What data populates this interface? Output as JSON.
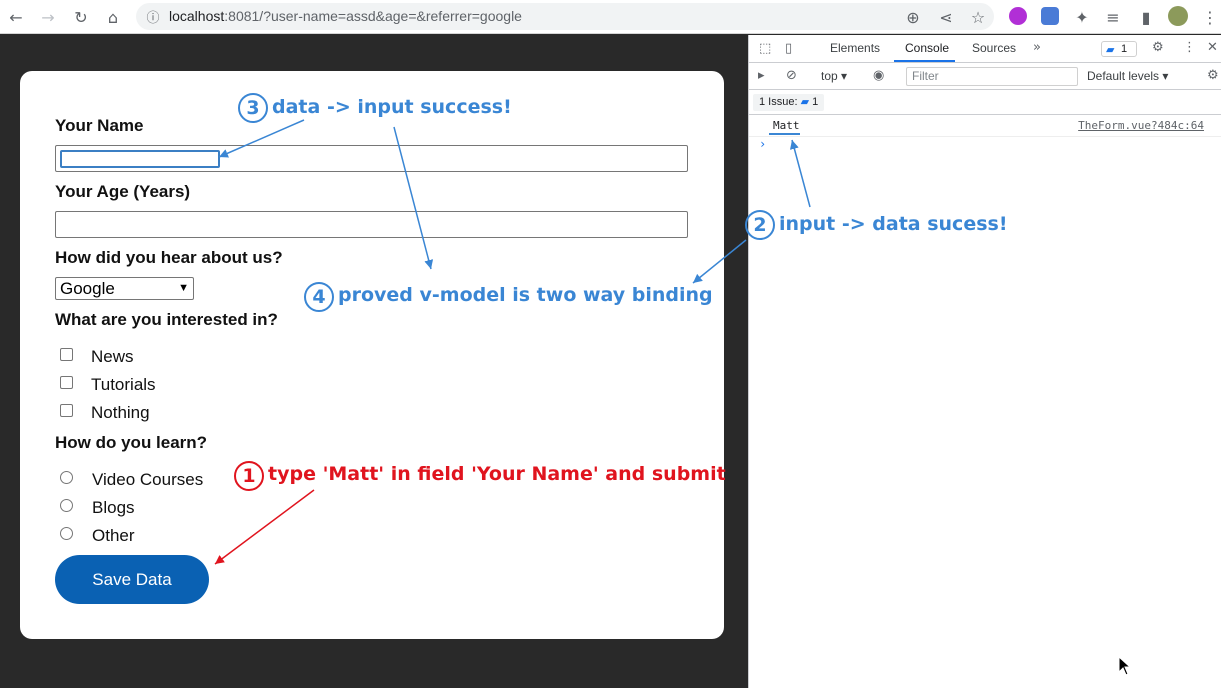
{
  "browser": {
    "url_host": "localhost",
    "url_rest": ":8081/?user-name=assd&age=&referrer=google"
  },
  "form": {
    "name_label": "Your Name",
    "name_value": "",
    "age_label": "Your Age (Years)",
    "age_value": "",
    "referrer_label": "How did you hear about us?",
    "referrer_value": "Google",
    "interest_label": "What are you interested in?",
    "interests": [
      {
        "label": "News",
        "checked": false
      },
      {
        "label": "Tutorials",
        "checked": false
      },
      {
        "label": "Nothing",
        "checked": false
      }
    ],
    "learn_label": "How do you learn?",
    "learn_options": [
      {
        "label": "Video Courses",
        "selected": false
      },
      {
        "label": "Blogs",
        "selected": false
      },
      {
        "label": "Other",
        "selected": false
      }
    ],
    "save_label": "Save Data"
  },
  "devtools": {
    "tabs": [
      "Elements",
      "Console",
      "Sources"
    ],
    "active_tab": "Console",
    "issue_badge_count": "1",
    "context": "top",
    "filter_placeholder": "Filter",
    "levels": "Default levels",
    "issues_label": "1 Issue:",
    "issues_count": "1",
    "log_text": "Matt",
    "log_source": "TheForm.vue?484c:64",
    "prompt": "›"
  },
  "annotations": [
    {
      "num": "1",
      "text": "type 'Matt' in field 'Your Name' and submit",
      "color": "#e0141e"
    },
    {
      "num": "2",
      "text": "input -> data sucess!",
      "color": "#3a86d4"
    },
    {
      "num": "3",
      "text": "data -> input success!",
      "color": "#3a86d4"
    },
    {
      "num": "4",
      "text": "proved v-model is two way binding",
      "color": "#3a86d4"
    }
  ],
  "colors": {
    "accent_blue": "#3a86d4",
    "accent_red": "#e0141e",
    "button": "#0a61b3",
    "page_bg": "#292929"
  }
}
